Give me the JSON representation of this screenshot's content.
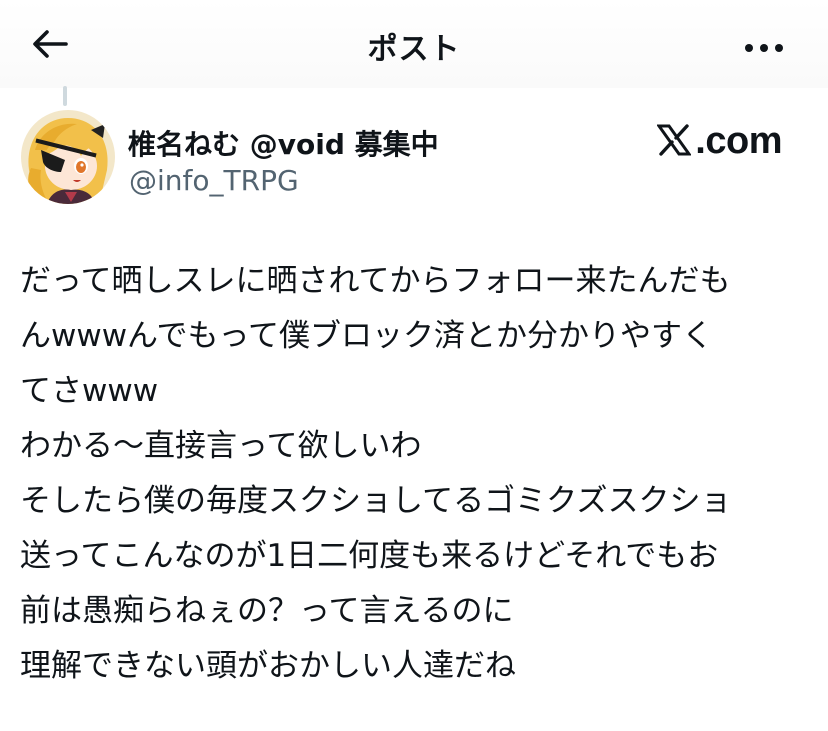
{
  "header": {
    "title": "ポスト"
  },
  "icons": {
    "back": "arrow-left-icon",
    "more": "more-horizontal-icon",
    "logo": "x-logo-icon"
  },
  "author": {
    "display_name": "椎名ねむ @void 募集中",
    "handle": "@info_TRPG"
  },
  "branding": {
    "domain": ".com"
  },
  "post": {
    "lines": [
      "だって晒しスレに晒されてからフォロー来たんだも",
      "んwwwんでもって僕ブロック済とか分かりやすく",
      "てさwww",
      "わかる〜直接言って欲しいわ",
      "そしたら僕の毎度スクショしてるゴミクズスクショ",
      "送ってこんなのが1日二何度も来るけどそれでもお",
      "前は愚痴らねぇの？って言えるのに",
      "理解できない頭がおかしい人達だね"
    ]
  },
  "colors": {
    "text": "#0f1419",
    "secondary": "#536471",
    "thread_line": "#cfd9de"
  }
}
